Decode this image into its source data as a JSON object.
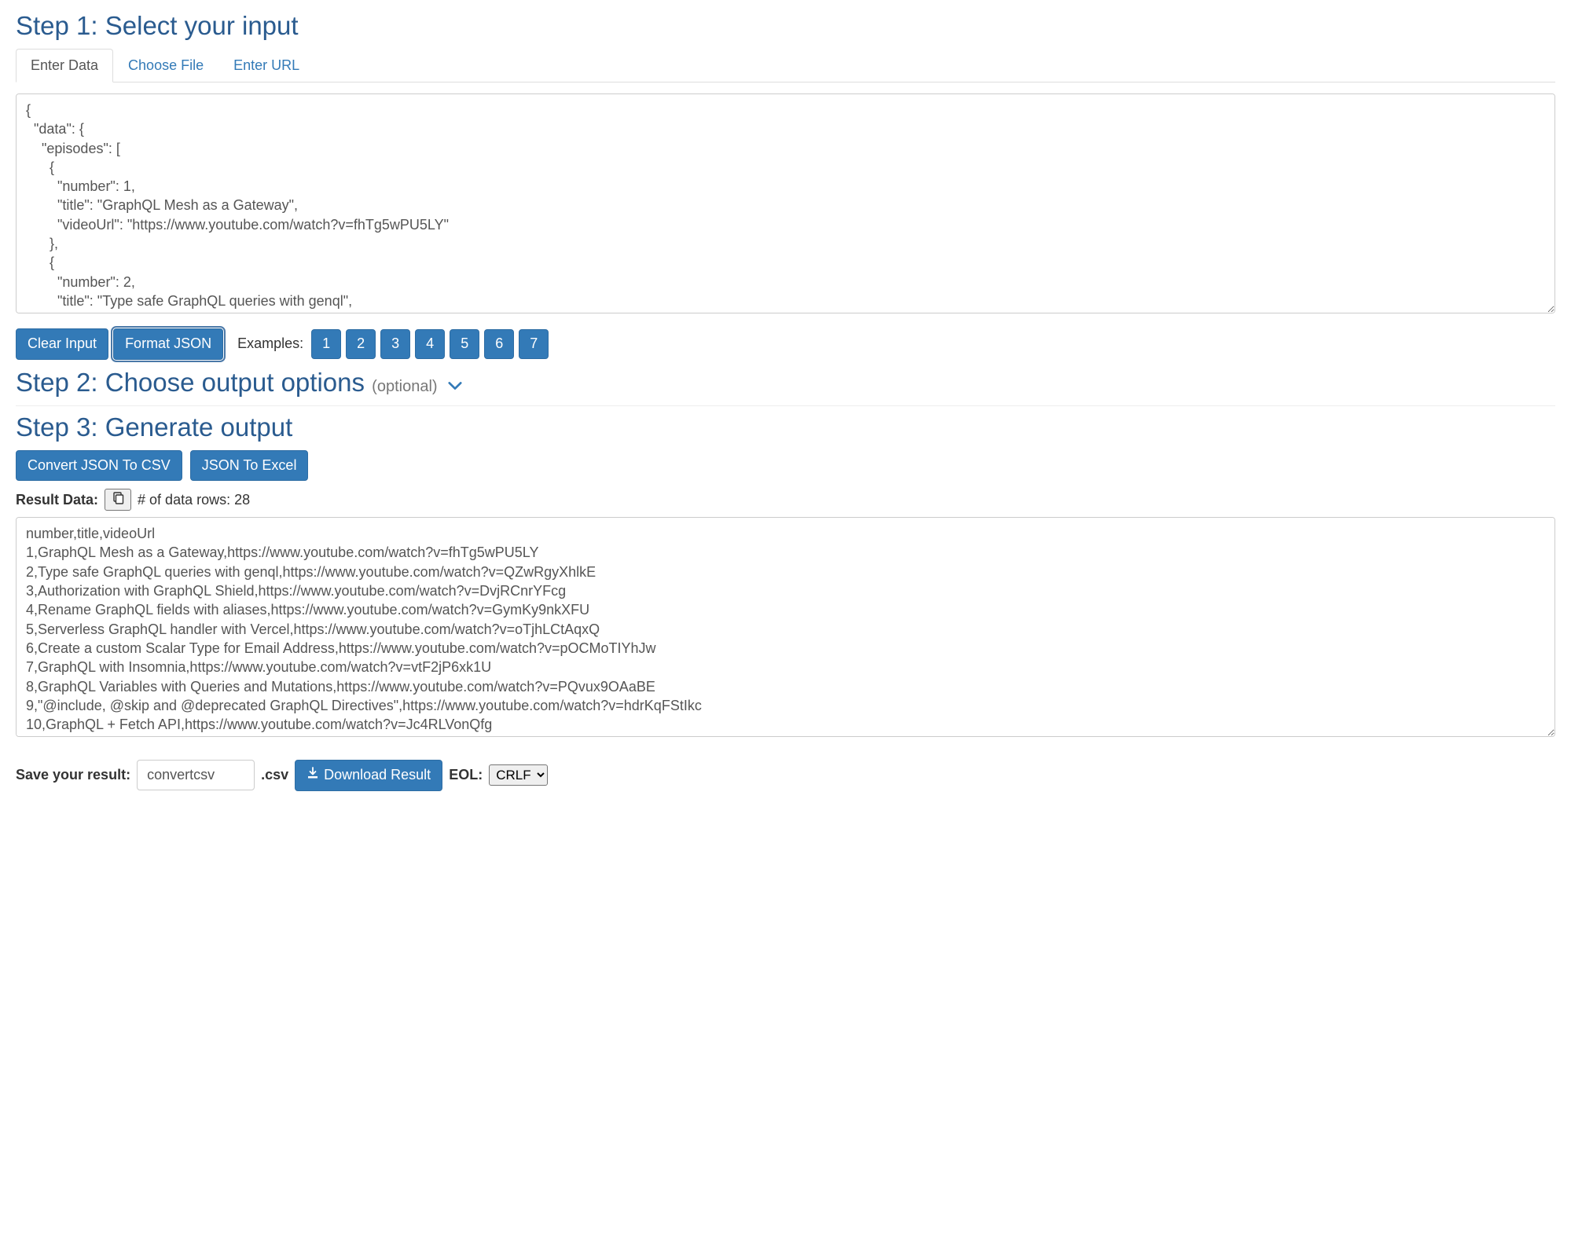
{
  "step1": {
    "title": "Step 1: Select your input",
    "tabs": [
      {
        "label": "Enter Data",
        "active": true
      },
      {
        "label": "Choose File",
        "active": false
      },
      {
        "label": "Enter URL",
        "active": false
      }
    ],
    "input_text": "{\n  \"data\": {\n    \"episodes\": [\n      {\n        \"number\": 1,\n        \"title\": \"GraphQL Mesh as a Gateway\",\n        \"videoUrl\": \"https://www.youtube.com/watch?v=fhTg5wPU5LY\"\n      },\n      {\n        \"number\": 2,\n        \"title\": \"Type safe GraphQL queries with genql\",",
    "clear_label": "Clear Input",
    "format_label": "Format JSON",
    "examples_label": "Examples:",
    "examples": [
      "1",
      "2",
      "3",
      "4",
      "5",
      "6",
      "7"
    ]
  },
  "step2": {
    "title": "Step 2: Choose output options",
    "optional": "(optional)"
  },
  "step3": {
    "title": "Step 3: Generate output",
    "convert_csv_label": "Convert JSON To CSV",
    "json_excel_label": "JSON To Excel",
    "result_label": "Result Data:",
    "row_count_text": "# of data rows: 28",
    "output_text": "number,title,videoUrl\n1,GraphQL Mesh as a Gateway,https://www.youtube.com/watch?v=fhTg5wPU5LY\n2,Type safe GraphQL queries with genql,https://www.youtube.com/watch?v=QZwRgyXhlkE\n3,Authorization with GraphQL Shield,https://www.youtube.com/watch?v=DvjRCnrYFcg\n4,Rename GraphQL fields with aliases,https://www.youtube.com/watch?v=GymKy9nkXFU\n5,Serverless GraphQL handler with Vercel,https://www.youtube.com/watch?v=oTjhLCtAqxQ\n6,Create a custom Scalar Type for Email Address,https://www.youtube.com/watch?v=pOCMoTIYhJw\n7,GraphQL with Insomnia,https://www.youtube.com/watch?v=vtF2jP6xk1U\n8,GraphQL Variables with Queries and Mutations,https://www.youtube.com/watch?v=PQvux9OAaBE\n9,\"@include, @skip and @deprecated GraphQL Directives\",https://www.youtube.com/watch?v=hdrKqFStIkc\n10,GraphQL + Fetch API,https://www.youtube.com/watch?v=Jc4RLVonQfg",
    "save_label": "Save your result:",
    "filename": "convertcsv",
    "extension": ".csv",
    "download_label": "Download Result",
    "eol_label": "EOL:",
    "eol_value": "CRLF"
  }
}
